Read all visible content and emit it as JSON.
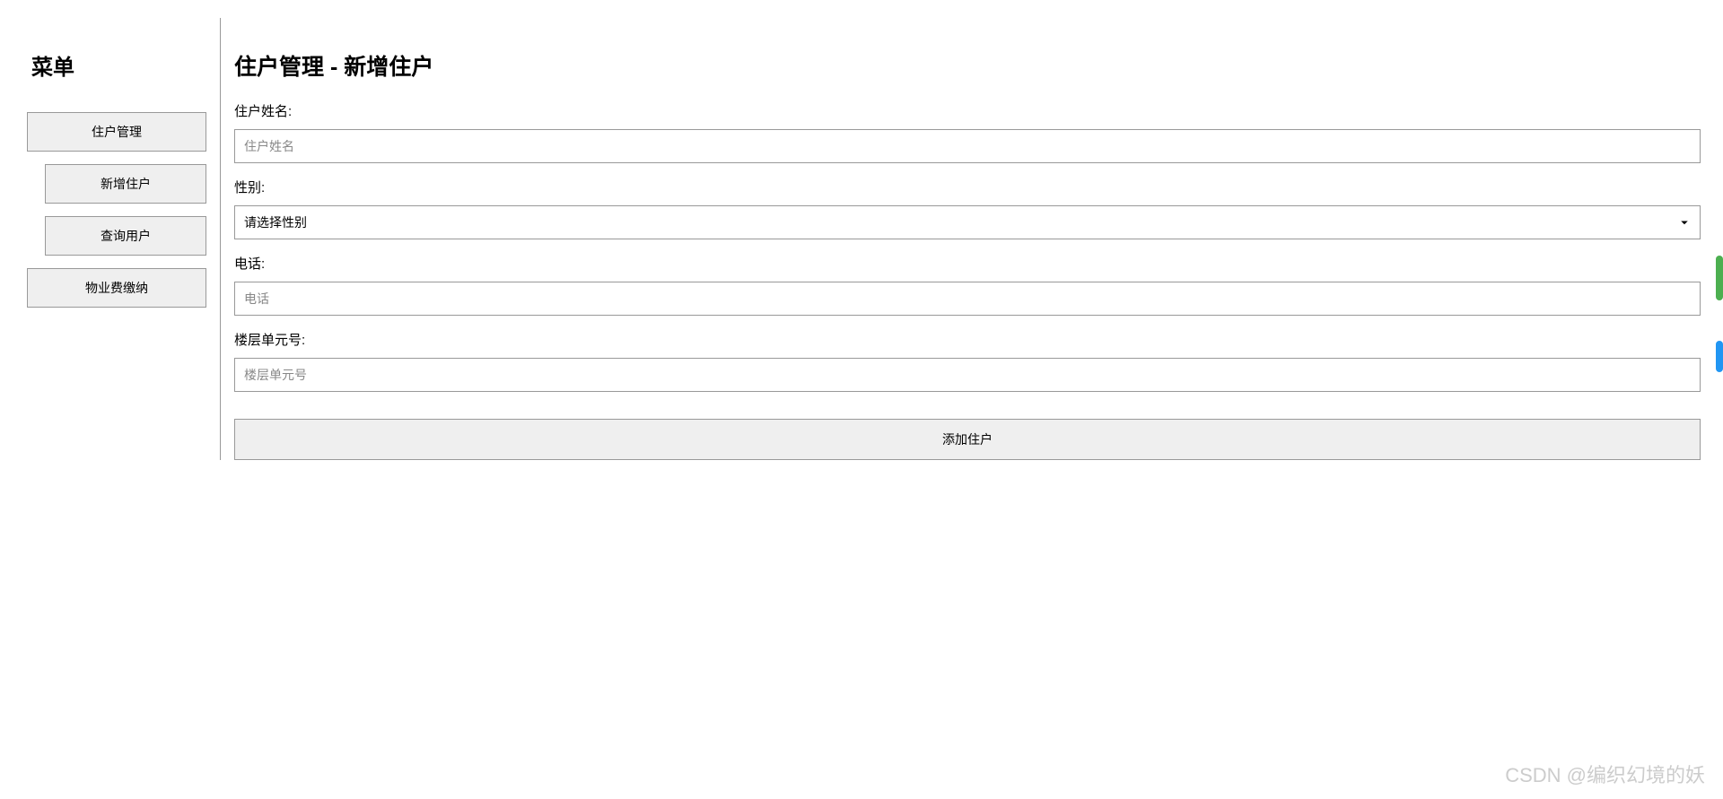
{
  "sidebar": {
    "title": "菜单",
    "items": [
      {
        "label": "住户管理",
        "indent": false
      },
      {
        "label": "新增住户",
        "indent": true
      },
      {
        "label": "查询用户",
        "indent": true
      },
      {
        "label": "物业费缴纳",
        "indent": false
      }
    ]
  },
  "main": {
    "title": "住户管理 - 新增住户",
    "fields": {
      "name": {
        "label": "住户姓名:",
        "placeholder": "住户姓名"
      },
      "gender": {
        "label": "性别:",
        "placeholder": "请选择性别"
      },
      "phone": {
        "label": "电话:",
        "placeholder": "电话"
      },
      "unit": {
        "label": "楼层单元号:",
        "placeholder": "楼层单元号"
      }
    },
    "submit_label": "添加住户"
  },
  "watermark": "CSDN @编织幻境的妖"
}
